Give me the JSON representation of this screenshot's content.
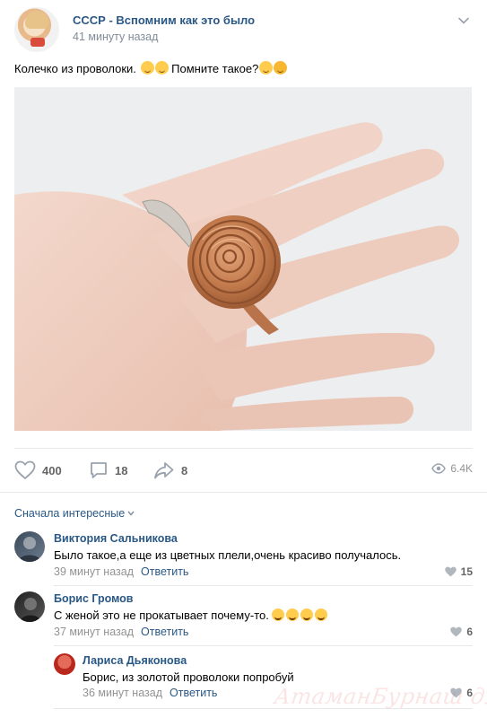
{
  "post": {
    "group_name": "СССР - Вспомним как это было",
    "time": "41 минуту назад",
    "text_part1": "Колечко из проволоки.",
    "text_part2": "Помните такое?",
    "emojis_after_part1": [
      "smile-emoji",
      "hug-emoji"
    ],
    "emojis_after_part2": [
      "thinking-emoji",
      "heart-eyes-emoji"
    ],
    "photo_icon": "hand-with-wire-rose-ring-photo"
  },
  "actions": {
    "likes": "400",
    "comments": "18",
    "shares": "8",
    "views": "6.4K"
  },
  "comments_sort": "Сначала интересные",
  "comments": [
    {
      "author": "Виктория Сальникова",
      "text": "Было такое,а еще из цветных плели,очень красиво получалось.",
      "time": "39 минут назад",
      "reply_label": "Ответить",
      "likes": "15"
    },
    {
      "author": "Борис Громов",
      "text": "С женой это не прокатывает почему-то.",
      "time": "37 минут назад",
      "reply_label": "Ответить",
      "likes": "6",
      "emoji": "rofl-emoji",
      "emoji_count": 4
    },
    {
      "author": "Лариса Дьяконова",
      "text": "Борис, из золотой проволоки попробуй",
      "time": "36 минут назад",
      "reply_label": "Ответить",
      "likes": "6"
    }
  ],
  "watermark": "АтаманБурнаш для ЯП",
  "colors": {
    "link": "#2a5885",
    "secondary": "#818c99",
    "divider": "#e7e8ec",
    "icon": "#99a2ad"
  }
}
